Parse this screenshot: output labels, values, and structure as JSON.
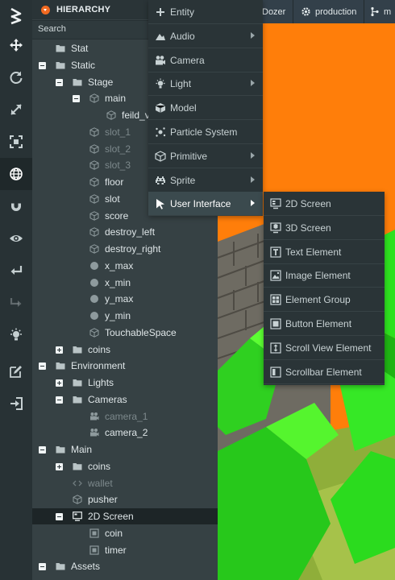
{
  "toolbar": {
    "logo": "logo-icon",
    "tools": [
      "translate-icon",
      "rotate-icon",
      "scale-icon",
      "resize-icon",
      "world-icon",
      "magnet-icon",
      "eye-icon",
      "undo-icon",
      "redo-icon",
      "light-icon",
      "edit-icon",
      "publish-icon"
    ],
    "active_tool": "world-icon"
  },
  "hierarchy": {
    "title": "HIERARCHY",
    "search_placeholder": "Search",
    "accent": "#f26a21",
    "rows": [
      {
        "label": "Stat",
        "depth": 0,
        "toggle": "none",
        "icon": "folder",
        "state": "normal"
      },
      {
        "label": "Static",
        "depth": 0,
        "toggle": "minus",
        "icon": "folder",
        "state": "normal"
      },
      {
        "label": "Stage",
        "depth": 1,
        "toggle": "minus",
        "icon": "folder",
        "state": "normal"
      },
      {
        "label": "main",
        "depth": 2,
        "toggle": "minus",
        "icon": "cube",
        "state": "normal"
      },
      {
        "label": "feild_v",
        "depth": 3,
        "toggle": "none",
        "icon": "cube",
        "state": "normal"
      },
      {
        "label": "slot_1",
        "depth": 2,
        "toggle": "none",
        "icon": "cube",
        "state": "off"
      },
      {
        "label": "slot_2",
        "depth": 2,
        "toggle": "none",
        "icon": "cube",
        "state": "off"
      },
      {
        "label": "slot_3",
        "depth": 2,
        "toggle": "none",
        "icon": "cube",
        "state": "off"
      },
      {
        "label": "floor",
        "depth": 2,
        "toggle": "none",
        "icon": "cube",
        "state": "normal"
      },
      {
        "label": "slot",
        "depth": 2,
        "toggle": "none",
        "icon": "cube",
        "state": "normal"
      },
      {
        "label": "score",
        "depth": 2,
        "toggle": "none",
        "icon": "cube",
        "state": "normal"
      },
      {
        "label": "destroy_left",
        "depth": 2,
        "toggle": "none",
        "icon": "cube",
        "state": "normal"
      },
      {
        "label": "destroy_right",
        "depth": 2,
        "toggle": "none",
        "icon": "cube",
        "state": "normal"
      },
      {
        "label": "x_max",
        "depth": 2,
        "toggle": "none",
        "icon": "sphere",
        "state": "normal"
      },
      {
        "label": "x_min",
        "depth": 2,
        "toggle": "none",
        "icon": "sphere",
        "state": "normal"
      },
      {
        "label": "y_max",
        "depth": 2,
        "toggle": "none",
        "icon": "sphere",
        "state": "normal"
      },
      {
        "label": "y_min",
        "depth": 2,
        "toggle": "none",
        "icon": "sphere",
        "state": "normal"
      },
      {
        "label": "TouchableSpace",
        "depth": 2,
        "toggle": "none",
        "icon": "cube",
        "state": "normal"
      },
      {
        "label": "coins",
        "depth": 1,
        "toggle": "plus",
        "icon": "folder",
        "state": "normal"
      },
      {
        "label": "Environment",
        "depth": 0,
        "toggle": "minus",
        "icon": "folder",
        "state": "normal"
      },
      {
        "label": "Lights",
        "depth": 1,
        "toggle": "plus",
        "icon": "folder",
        "state": "normal"
      },
      {
        "label": "Cameras",
        "depth": 1,
        "toggle": "minus",
        "icon": "folder",
        "state": "normal"
      },
      {
        "label": "camera_1",
        "depth": 2,
        "toggle": "none",
        "icon": "camera",
        "state": "off"
      },
      {
        "label": "camera_2",
        "depth": 2,
        "toggle": "none",
        "icon": "camera",
        "state": "normal"
      },
      {
        "label": "Main",
        "depth": 0,
        "toggle": "minus",
        "icon": "folder",
        "state": "normal"
      },
      {
        "label": "coins",
        "depth": 1,
        "toggle": "plus",
        "icon": "folder",
        "state": "normal"
      },
      {
        "label": "wallet",
        "depth": 1,
        "toggle": "none",
        "icon": "code",
        "state": "off"
      },
      {
        "label": "pusher",
        "depth": 1,
        "toggle": "none",
        "icon": "cube",
        "state": "normal"
      },
      {
        "label": "2D Screen",
        "depth": 1,
        "toggle": "minus",
        "icon": "screen",
        "state": "selected"
      },
      {
        "label": "coin",
        "depth": 2,
        "toggle": "none",
        "icon": "element",
        "state": "normal"
      },
      {
        "label": "timer",
        "depth": 2,
        "toggle": "none",
        "icon": "element",
        "state": "normal"
      },
      {
        "label": "Assets",
        "depth": 0,
        "toggle": "minus",
        "icon": "folder",
        "state": "normal"
      }
    ]
  },
  "topbar": {
    "project": "Dozer",
    "branch_label": "production",
    "extra_label": "m"
  },
  "context_menu": {
    "items": [
      {
        "label": "Entity",
        "icon": "plus-icon",
        "submenu": false
      },
      {
        "label": "Audio",
        "icon": "audio-icon",
        "submenu": true
      },
      {
        "label": "Camera",
        "icon": "camera-icon",
        "submenu": false
      },
      {
        "label": "Light",
        "icon": "light-icon",
        "submenu": true
      },
      {
        "label": "Model",
        "icon": "model-icon",
        "submenu": false
      },
      {
        "label": "Particle System",
        "icon": "particle-icon",
        "submenu": false
      },
      {
        "label": "Primitive",
        "icon": "primitive-icon",
        "submenu": true
      },
      {
        "label": "Sprite",
        "icon": "sprite-icon",
        "submenu": true
      },
      {
        "label": "User Interface",
        "icon": "cursor-icon",
        "submenu": true
      }
    ],
    "highlighted": "User Interface"
  },
  "ui_submenu": {
    "items": [
      {
        "label": "2D Screen",
        "icon": "screen-2d-icon"
      },
      {
        "label": "3D Screen",
        "icon": "screen-3d-icon"
      },
      {
        "label": "Text Element",
        "icon": "text-element-icon"
      },
      {
        "label": "Image Element",
        "icon": "image-element-icon"
      },
      {
        "label": "Element Group",
        "icon": "element-group-icon"
      },
      {
        "label": "Button Element",
        "icon": "button-element-icon"
      },
      {
        "label": "Scroll View Element",
        "icon": "scroll-view-icon"
      },
      {
        "label": "Scrollbar Element",
        "icon": "scrollbar-element-icon"
      }
    ]
  }
}
